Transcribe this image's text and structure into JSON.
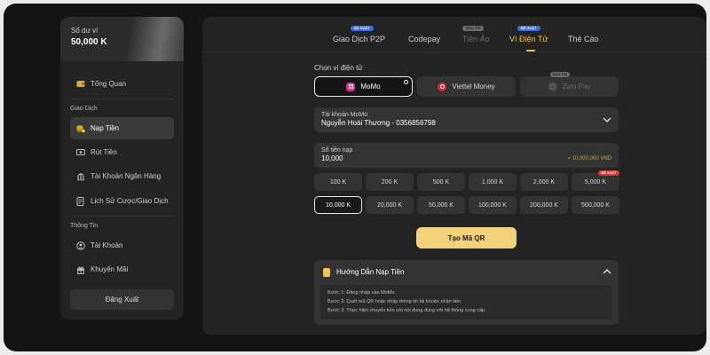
{
  "sidebar": {
    "balance_label": "Số dư ví",
    "balance_value": "50,000 K",
    "overview": "Tổng Quan",
    "section_transactions": "Giao Dịch",
    "deposit": "Nạp Tiền",
    "withdraw": "Rút Tiền",
    "bank_account": "Tài Khoản Ngân Hàng",
    "history": "Lịch Sử Cược/Giao Dịch",
    "section_info": "Thông Tin",
    "account": "Tài Khoản",
    "promotion": "Khuyến Mãi",
    "logout": "Đăng Xuất"
  },
  "tabs": [
    {
      "label": "Giao Dịch P2P",
      "badge": "ĐỀ XUẤT"
    },
    {
      "label": "Codepay",
      "badge": ""
    },
    {
      "label": "Tiền Ảo",
      "badge": "BẢO TRÌ"
    },
    {
      "label": "Ví Điện Tử",
      "badge": "ĐỀ XUẤT"
    },
    {
      "label": "Thẻ Cào",
      "badge": ""
    }
  ],
  "wallet_section": {
    "label": "Chọn ví điện tử",
    "options": [
      {
        "label": "MoMo"
      },
      {
        "label": "Viettel Money"
      },
      {
        "label": "Zalo Pay",
        "badge": "BẢO TRÌ"
      }
    ]
  },
  "account_field": {
    "label": "Tài khoản MoMo",
    "value": "Nguyễn Hoài Thương - 0356856798"
  },
  "amount_field": {
    "label": "Số tiền nạp",
    "value": "10,000",
    "hint": "= 10,000,000 VND"
  },
  "amounts": [
    "100 K",
    "200 K",
    "500 K",
    "1,000 K",
    "2,000 K",
    "5,000 K",
    "10,000 K",
    "20,000 K",
    "50,000 K",
    "100,000 K",
    "200,000 K",
    "500,000 K"
  ],
  "amount_badge": "ĐỀ XUẤT",
  "qr_button": "Tạo Mã QR",
  "guide": {
    "title": "Hướng Dẫn Nạp Tiền",
    "steps": [
      "Bước 1: Đăng nhập vào MoMo.",
      "Bước 2: Quét mã QR hoặc nhập thông tin tài khoản nhận tiền.",
      "Bước 3: Thực hiện chuyển tiền với nội dung đúng với hệ thống cung cấp."
    ]
  },
  "colors": {
    "accent": "#f0c44c",
    "button": "#f4d27c",
    "badge_blue": "#3d6fe0",
    "badge_red": "#d23a3a"
  }
}
